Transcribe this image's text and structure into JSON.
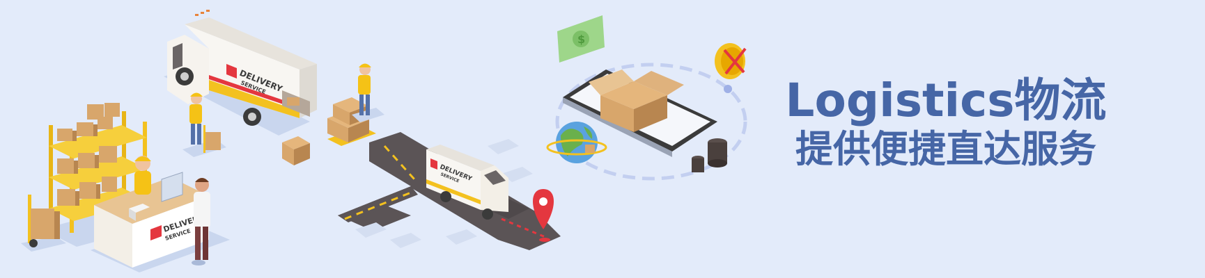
{
  "headline": {
    "line1": "Logistics物流",
    "line2": "提供便捷直达服务"
  },
  "truck_brand": {
    "name": "DELIVERY",
    "sub": "SERVICE"
  },
  "counter_brand": {
    "name": "DELIVERY",
    "sub": "SERVICE"
  },
  "road_truck_brand": {
    "name": "DELIVERY",
    "sub": "SERVICE"
  },
  "money_symbol": "$",
  "colors": {
    "background": "#e3ebfa",
    "headline": "#4666a6",
    "box": "#d8a66b",
    "shelf": "#f3c11f",
    "uniform": "#f5c216",
    "road": "#5b5456",
    "pin": "#e4373f"
  }
}
